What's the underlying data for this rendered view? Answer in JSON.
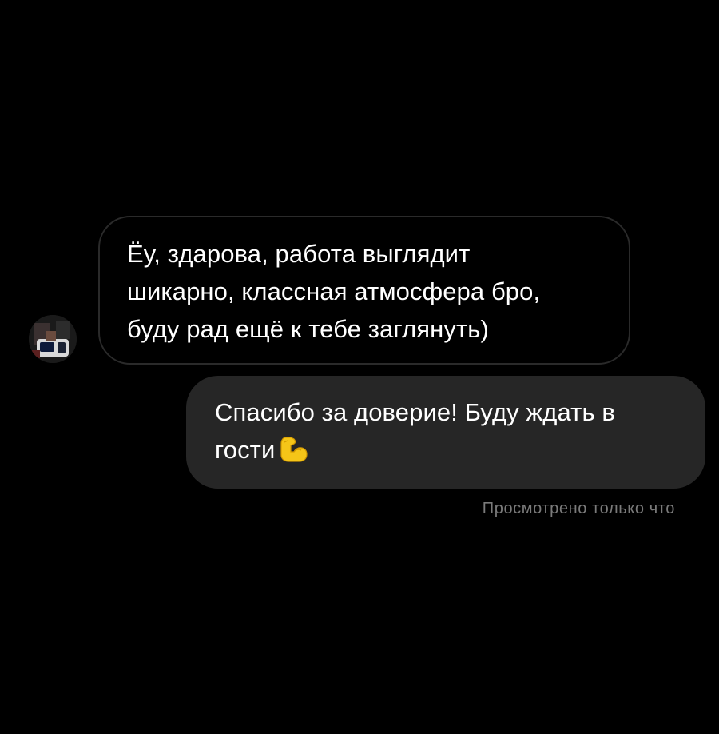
{
  "incoming_message": {
    "text": "Ёу, здарова, работа выглядит\nшикарно, классная атмосфера бро,\nбуду рад ещё к тебе заглянуть)"
  },
  "outgoing_message": {
    "text": "Спасибо за доверие! Буду ждать в\nгости",
    "emoji": "flexed-biceps-icon"
  },
  "status": {
    "seen_label": "Просмотрено только что"
  },
  "colors": {
    "background": "#000000",
    "incoming_bubble_border": "#2a2a2a",
    "outgoing_bubble_fill": "#262626",
    "text": "#ffffff",
    "status_text": "#7a7a7a"
  }
}
